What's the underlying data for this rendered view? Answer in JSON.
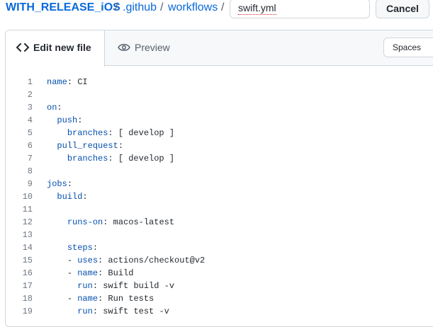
{
  "breadcrumb": {
    "repo": "WITH_RELEASE_iOS",
    "separator": "/",
    "folder1": ".github",
    "folder2": "workflows"
  },
  "filename": {
    "value": "swift.yml"
  },
  "cancel_label": "Cancel",
  "tabs": {
    "edit_label": "Edit new file",
    "preview_label": "Preview"
  },
  "indent_mode": {
    "selected": "Spaces"
  },
  "colors": {
    "link": "#0969da",
    "yaml_key": "#0550ae",
    "text": "#24292f",
    "line_number": "#6e7781"
  },
  "code": {
    "lines": [
      {
        "n": "1",
        "indent": "",
        "dash": "",
        "key": "name",
        "value": " CI"
      },
      {
        "n": "2",
        "indent": "",
        "dash": "",
        "key": "",
        "value": ""
      },
      {
        "n": "3",
        "indent": "",
        "dash": "",
        "key": "on",
        "value": ""
      },
      {
        "n": "4",
        "indent": "  ",
        "dash": "",
        "key": "push",
        "value": ""
      },
      {
        "n": "5",
        "indent": "    ",
        "dash": "",
        "key": "branches",
        "value": " [ develop ]"
      },
      {
        "n": "6",
        "indent": "  ",
        "dash": "",
        "key": "pull_request",
        "value": ""
      },
      {
        "n": "7",
        "indent": "    ",
        "dash": "",
        "key": "branches",
        "value": " [ develop ]"
      },
      {
        "n": "8",
        "indent": "",
        "dash": "",
        "key": "",
        "value": ""
      },
      {
        "n": "9",
        "indent": "",
        "dash": "",
        "key": "jobs",
        "value": ""
      },
      {
        "n": "10",
        "indent": "  ",
        "dash": "",
        "key": "build",
        "value": ""
      },
      {
        "n": "11",
        "indent": "",
        "dash": "",
        "key": "",
        "value": ""
      },
      {
        "n": "12",
        "indent": "    ",
        "dash": "",
        "key": "runs-on",
        "value": " macos-latest"
      },
      {
        "n": "13",
        "indent": "",
        "dash": "",
        "key": "",
        "value": ""
      },
      {
        "n": "14",
        "indent": "    ",
        "dash": "",
        "key": "steps",
        "value": ""
      },
      {
        "n": "15",
        "indent": "    ",
        "dash": "- ",
        "key": "uses",
        "value": " actions/checkout@v2"
      },
      {
        "n": "16",
        "indent": "    ",
        "dash": "- ",
        "key": "name",
        "value": " Build"
      },
      {
        "n": "17",
        "indent": "      ",
        "dash": "",
        "key": "run",
        "value": " swift build -v"
      },
      {
        "n": "18",
        "indent": "    ",
        "dash": "- ",
        "key": "name",
        "value": " Run tests"
      },
      {
        "n": "19",
        "indent": "      ",
        "dash": "",
        "key": "run",
        "value": " swift test -v"
      }
    ]
  }
}
